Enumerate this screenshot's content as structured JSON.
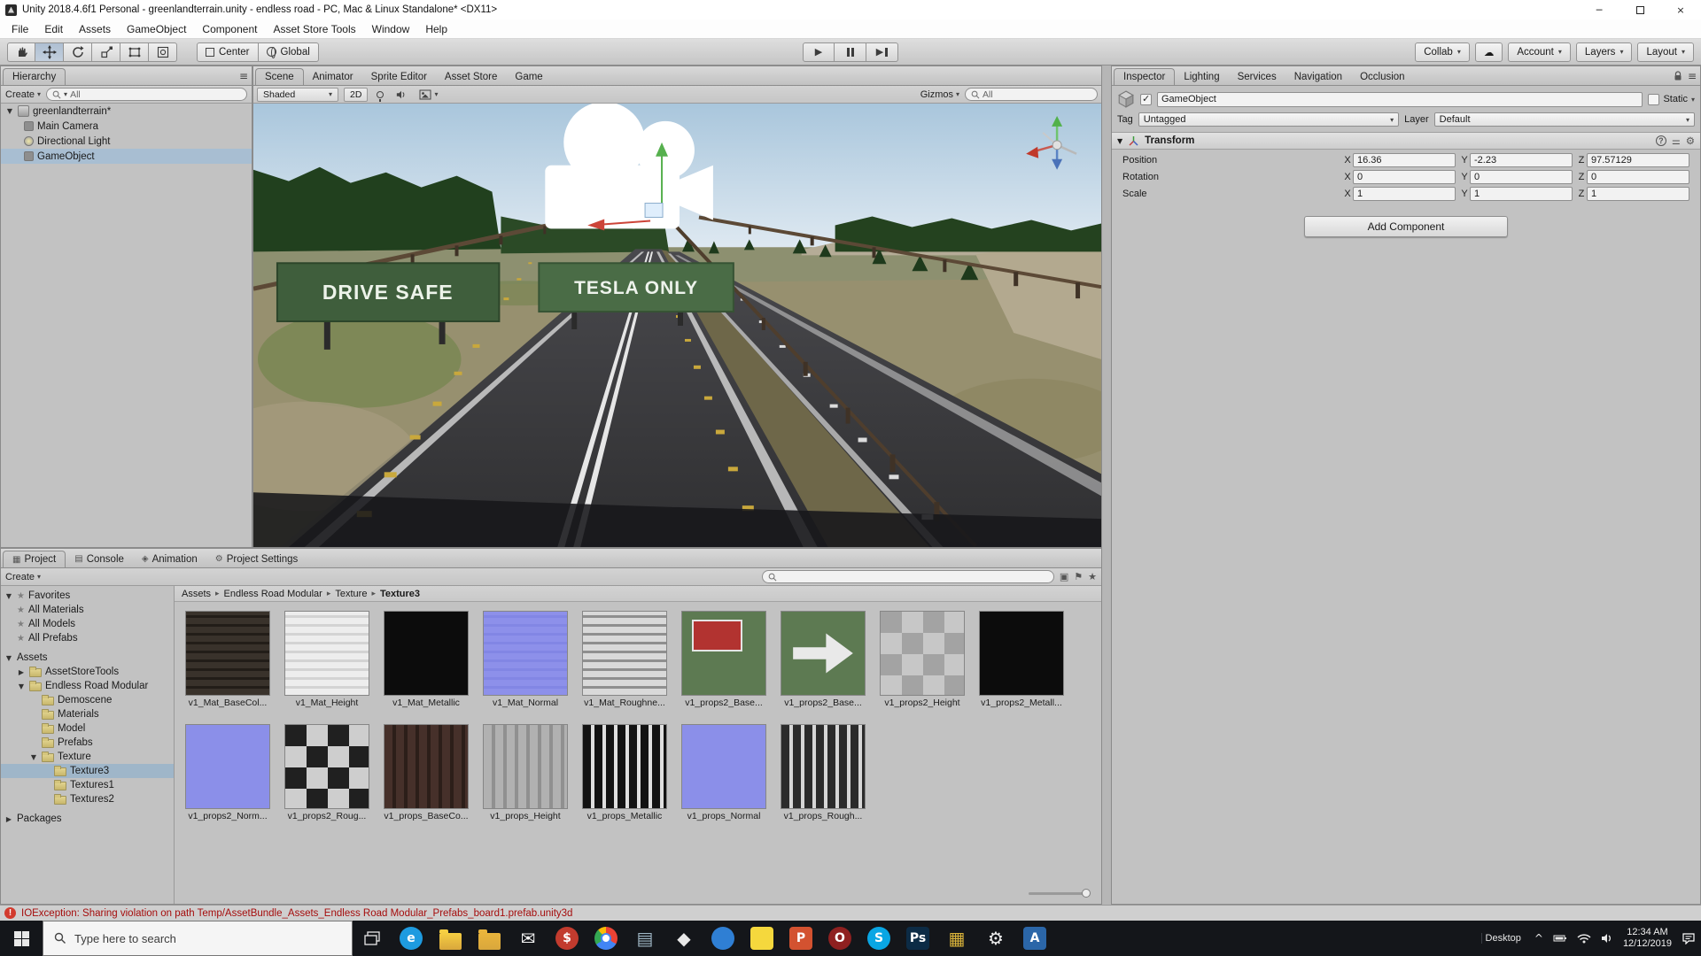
{
  "window": {
    "title": "Unity 2018.4.6f1 Personal - greenlandterrain.unity - endless road - PC, Mac & Linux Standalone* <DX11>",
    "menus": [
      "File",
      "Edit",
      "Assets",
      "GameObject",
      "Component",
      "Asset Store Tools",
      "Window",
      "Help"
    ]
  },
  "icons": {
    "dropdown_arrow": "▾",
    "foldout_open": "▼",
    "foldout_closed": "▶",
    "hamburger": "≡",
    "gear": "⚙",
    "cloud": "☁",
    "star": "★",
    "breadcrumb_sep": "▸",
    "close": "×",
    "minimize": "─",
    "play": "▶",
    "question": "?",
    "exclamation": "!",
    "chevron_up": "^",
    "presets": "⚌"
  },
  "toolbar": {
    "pivot_label": "Center",
    "space_label": "Global",
    "collab_label": "Collab",
    "account_label": "Account",
    "layers_label": "Layers",
    "layout_label": "Layout"
  },
  "hierarchy": {
    "tab": "Hierarchy",
    "create_label": "Create",
    "search_filter": "All",
    "scene_name": "greenlandterrain*",
    "items": [
      "Main Camera",
      "Directional Light",
      "GameObject"
    ]
  },
  "scene": {
    "tabs": [
      {
        "name": "scene",
        "label": "Scene"
      },
      {
        "name": "animator",
        "label": "Animator"
      },
      {
        "name": "sprite-editor",
        "label": "Sprite Editor"
      },
      {
        "name": "asset-store",
        "label": "Asset Store"
      },
      {
        "name": "game",
        "label": "Game"
      }
    ],
    "shading_mode": "Shaded",
    "mode_2d": "2D",
    "gizmos_label": "Gizmos",
    "search_filter": "All",
    "sign_left": "DRIVE SAFE",
    "sign_right": "TESLA ONLY"
  },
  "inspector": {
    "tabs": [
      {
        "name": "inspector",
        "label": "Inspector"
      },
      {
        "name": "lighting",
        "label": "Lighting"
      },
      {
        "name": "services",
        "label": "Services"
      },
      {
        "name": "navigation",
        "label": "Navigation"
      },
      {
        "name": "occlusion",
        "label": "Occlusion"
      }
    ],
    "object_name": "GameObject",
    "static_label": "Static",
    "tag_label": "Tag",
    "tag_value": "Untagged",
    "layer_label": "Layer",
    "layer_value": "Default",
    "component_title": "Transform",
    "axis_x": "X",
    "axis_y": "Y",
    "axis_z": "Z",
    "transform_rows": [
      {
        "label": "Position",
        "x": "16.36",
        "y": "-2.23",
        "z": "97.57129"
      },
      {
        "label": "Rotation",
        "x": "0",
        "y": "0",
        "z": "0"
      },
      {
        "label": "Scale",
        "x": "1",
        "y": "1",
        "z": "1"
      }
    ],
    "add_component_label": "Add Component"
  },
  "project": {
    "tabs": [
      {
        "name": "project",
        "label": "Project",
        "icon": "▦"
      },
      {
        "name": "console",
        "label": "Console",
        "icon": "▤"
      },
      {
        "name": "animation",
        "label": "Animation",
        "icon": "◈"
      },
      {
        "name": "project-settings",
        "label": "Project Settings",
        "icon": "⚙"
      }
    ],
    "create_label": "Create",
    "favorites_label": "Favorites",
    "favorites": [
      "All Materials",
      "All Models",
      "All Prefabs"
    ],
    "assets_label": "Assets",
    "folder_assetstoretools": "AssetStoreTools",
    "folder_endless": "Endless Road Modular",
    "endless_children": [
      "Demoscene",
      "Materials",
      "Model",
      "Prefabs"
    ],
    "folder_texture": "Texture",
    "texture_children": [
      "Texture3",
      "Textures1",
      "Textures2"
    ],
    "packages_label": "Packages",
    "breadcrumb": [
      "Assets",
      "Endless Road Modular",
      "Texture",
      "Texture3"
    ],
    "thumbnails": [
      {
        "name": "v1_Mat_BaseCol...",
        "kind": "kind-hlines",
        "tint": "#39322b",
        "tint2": "#221d18"
      },
      {
        "name": "v1_Mat_Height",
        "kind": "kind-hlines",
        "tint": "#ededed",
        "tint2": "#d3d3d3"
      },
      {
        "name": "v1_Mat_Metallic",
        "kind": "kind-plain",
        "tint": "#0c0c0c",
        "tint2": "#0c0c0c"
      },
      {
        "name": "v1_Mat_Normal",
        "kind": "kind-hlines",
        "tint": "#8d90ea",
        "tint2": "#8286e4"
      },
      {
        "name": "v1_Mat_Roughne...",
        "kind": "kind-hlines",
        "tint": "#d9d9d9",
        "tint2": "#8f8f8f"
      },
      {
        "name": "v1_props2_Base...",
        "kind": "kind-sign",
        "tint": "#5d7a52",
        "tint2": "#b23330"
      },
      {
        "name": "v1_props2_Base...",
        "kind": "kind-arrow",
        "tint": "#5d7a52",
        "tint2": "#e9e9e9"
      },
      {
        "name": "v1_props2_Height",
        "kind": "kind-blocks",
        "tint": "#a3a3a3",
        "tint2": "#c7c7c7"
      },
      {
        "name": "v1_props2_Metall...",
        "kind": "kind-plain",
        "tint": "#0c0c0c",
        "tint2": "#0c0c0c"
      },
      {
        "name": "v1_props2_Norm...",
        "kind": "kind-plain",
        "tint": "#8b8fe9",
        "tint2": "#8b8fe9"
      },
      {
        "name": "v1_props2_Roug...",
        "kind": "kind-blocks",
        "tint": "#202020",
        "tint2": "#cecece"
      },
      {
        "name": "v1_props_BaseCo...",
        "kind": "kind-vlines",
        "tint": "#46302a",
        "tint2": "#2c1e19"
      },
      {
        "name": "v1_props_Height",
        "kind": "kind-vlines",
        "tint": "#b1b1b1",
        "tint2": "#909090"
      },
      {
        "name": "v1_props_Metallic",
        "kind": "kind-vlines",
        "tint": "#121212",
        "tint2": "#dedede"
      },
      {
        "name": "v1_props_Normal",
        "kind": "kind-plain",
        "tint": "#8b8fe9",
        "tint2": "#8b8fe9"
      },
      {
        "name": "v1_props_Rough...",
        "kind": "kind-vlines",
        "tint": "#2b2b2b",
        "tint2": "#d6d6d6"
      }
    ]
  },
  "status": {
    "message": "IOException: Sharing violation on path Temp/AssetBundle_Assets_Endless Road Modular_Prefabs_board1.prefab.unity3d"
  },
  "taskbar": {
    "search_placeholder": "Type here to search",
    "desktop_label": "Desktop",
    "time": "12:34 AM",
    "date": "12/12/2019",
    "apps": [
      {
        "name": "edge",
        "glyph": "e",
        "shape": "app-circle",
        "color": "#1e9be0"
      },
      {
        "name": "file-explorer",
        "glyph": "",
        "shape": "app-folder",
        "color": "#f5ce42"
      },
      {
        "name": "folder-documents",
        "glyph": "",
        "shape": "app-folder",
        "color": "#e9b43c"
      },
      {
        "name": "mail",
        "glyph": "✉",
        "shape": "app-glyph",
        "color": "#f2f2f2"
      },
      {
        "name": "finance-app",
        "glyph": "$",
        "shape": "app-circle",
        "color": "#c23b2e"
      },
      {
        "name": "chrome",
        "glyph": "",
        "shape": "app-chrome",
        "color": "#e8453c"
      },
      {
        "name": "text-editor",
        "glyph": "▤",
        "shape": "app-glyph",
        "color": "#9fb6c4"
      },
      {
        "name": "unity-editor",
        "glyph": "◆",
        "shape": "app-glyph",
        "color": "#e8e8e8"
      },
      {
        "name": "browser",
        "glyph": "",
        "shape": "app-circle",
        "color": "#2f7fd4"
      },
      {
        "name": "sticky-notes",
        "glyph": "",
        "shape": "app-square",
        "color": "#f5d83d"
      },
      {
        "name": "powerpoint",
        "glyph": "P",
        "shape": "app-square",
        "color": "#d35230"
      },
      {
        "name": "opera",
        "glyph": "O",
        "shape": "app-circle",
        "color": "#8f2020"
      },
      {
        "name": "skype",
        "glyph": "S",
        "shape": "app-circle",
        "color": "#09a6e4"
      },
      {
        "name": "photoshop",
        "glyph": "Ps",
        "shape": "app-square",
        "color": "#0c2b45"
      },
      {
        "name": "photos-app",
        "glyph": "▦",
        "shape": "app-glyph",
        "color": "#d8b23a"
      },
      {
        "name": "settings",
        "glyph": "⚙",
        "shape": "app-glyph",
        "color": "#ededed"
      },
      {
        "name": "cad-app",
        "glyph": "A",
        "shape": "app-square",
        "color": "#2b66a8"
      }
    ]
  }
}
